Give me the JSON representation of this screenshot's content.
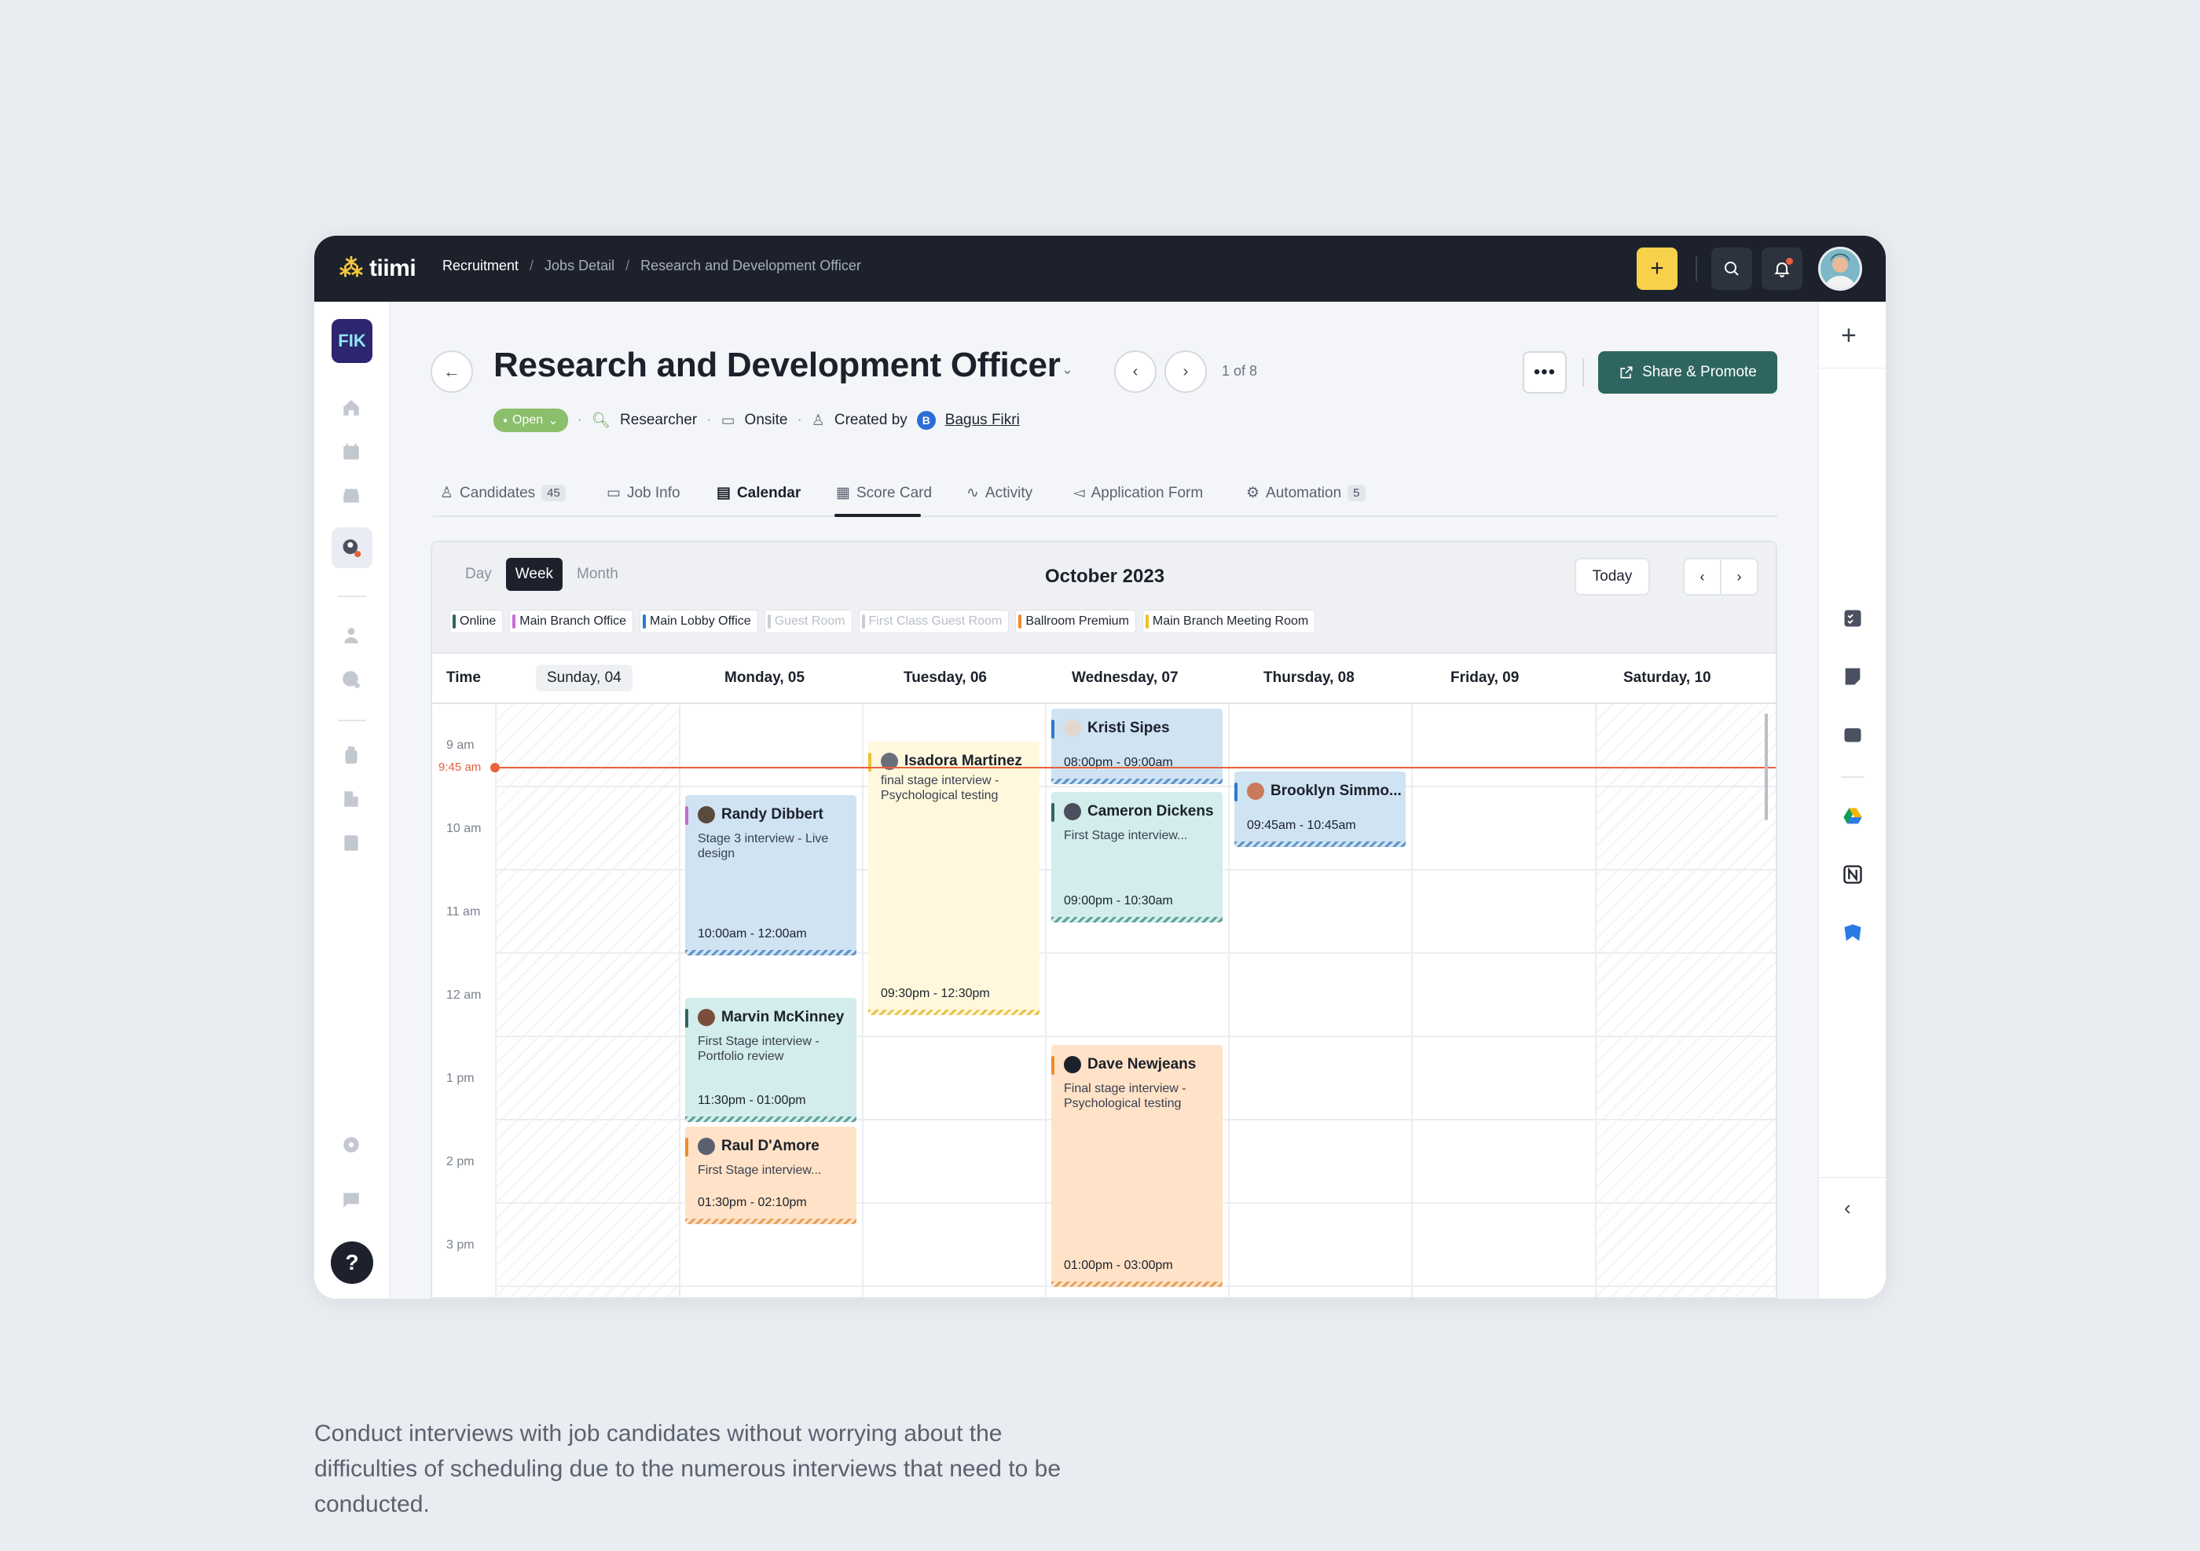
{
  "topbar": {
    "logo": "tiimi",
    "breadcrumb": [
      "Recruitment",
      "Jobs Detail",
      "Research and Development Officer"
    ]
  },
  "workspace": {
    "initials": "FIK"
  },
  "job": {
    "title": "Research and Development Officer",
    "pager": "1 of 8",
    "share_label": "Share & Promote",
    "status": "Open",
    "role": "Researcher",
    "location": "Onsite",
    "created_by_label": "Created by",
    "creator_initial": "B",
    "creator": "Bagus Fikri"
  },
  "tabs": [
    {
      "label": "Candidates",
      "count": "45"
    },
    {
      "label": "Job Info"
    },
    {
      "label": "Calendar"
    },
    {
      "label": "Score Card"
    },
    {
      "label": "Activity"
    },
    {
      "label": "Application Form"
    },
    {
      "label": "Automation",
      "count": "5"
    }
  ],
  "calendar": {
    "views": [
      "Day",
      "Week",
      "Month"
    ],
    "month": "October 2023",
    "today_label": "Today",
    "legend": [
      {
        "label": "Online",
        "color": "#2F6560"
      },
      {
        "label": "Main Branch Office",
        "color": "#C86BD6"
      },
      {
        "label": "Main Lobby Office",
        "color": "#2C7BC9"
      },
      {
        "label": "Guest Room",
        "color": "#C9CDD3"
      },
      {
        "label": "First Class Guest Room",
        "color": "#C9CDD3"
      },
      {
        "label": "Ballroom Premium",
        "color": "#F08A2C"
      },
      {
        "label": "Main Branch Meeting Room",
        "color": "#F0C02C"
      }
    ],
    "time_header": "Time",
    "days": [
      "Sunday, 04",
      "Monday, 05",
      "Tuesday, 06",
      "Wednesday, 07",
      "Thursday, 08",
      "Friday, 09",
      "Saturday, 10"
    ],
    "hours": [
      "9 am",
      "10 am",
      "11 am",
      "12 am",
      "1 pm",
      "2 pm",
      "3 pm"
    ],
    "now_label": "9:45 am",
    "events": [
      {
        "name": "Randy Dibbert",
        "desc": "Stage 3 interview - Live design",
        "time": "10:00am - 12:00am"
      },
      {
        "name": "Marvin McKinney",
        "desc": "First Stage interview - Portfolio review",
        "time": "11:30pm - 01:00pm"
      },
      {
        "name": "Raul D'Amore",
        "desc": "First Stage interview...",
        "time": "01:30pm - 02:10pm"
      },
      {
        "name": "Isadora Martinez",
        "desc": "final stage interview - Psychological testing",
        "time": "09:30pm - 12:30pm"
      },
      {
        "name": "Kristi Sipes",
        "desc": "",
        "time": "08:00pm - 09:00am"
      },
      {
        "name": "Cameron Dickens",
        "desc": "First Stage interview...",
        "time": "09:00pm - 10:30am"
      },
      {
        "name": "Dave Newjeans",
        "desc": "Final stage interview - Psychological testing",
        "time": "01:00pm - 03:00pm"
      },
      {
        "name": "Brooklyn Simmo...",
        "desc": "",
        "time": "09:45am - 10:45am"
      }
    ]
  },
  "caption": "Conduct interviews with job candidates without worrying about the difficulties of scheduling due to the numerous interviews that need to be conducted."
}
